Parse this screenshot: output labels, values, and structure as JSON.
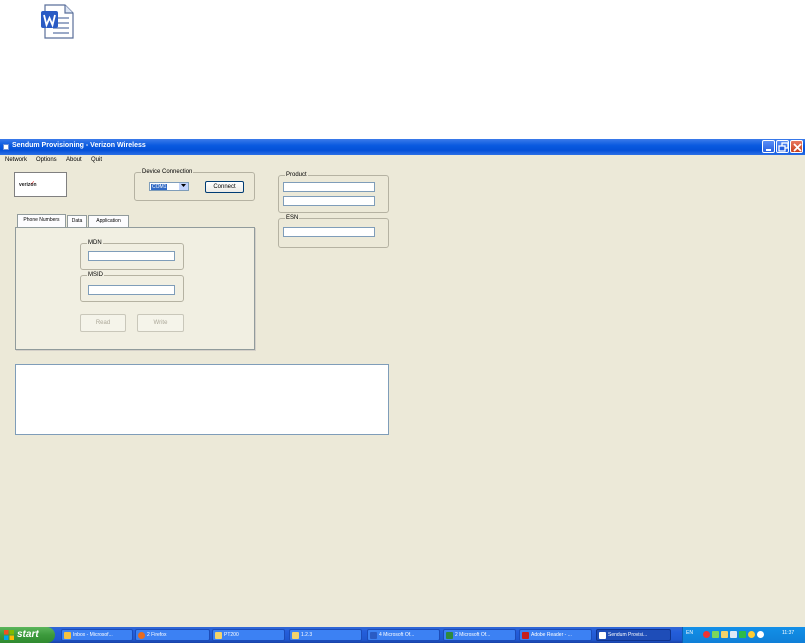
{
  "window": {
    "title": "Sendum Provisioning - Verizon Wireless"
  },
  "menu": [
    "Network",
    "Options",
    "About",
    "Quit"
  ],
  "logo": {
    "text": "verizon"
  },
  "device_connection": {
    "label": "Device Connection",
    "port_value": "COM1",
    "connect_label": "Connect"
  },
  "product": {
    "label": "Product"
  },
  "esn": {
    "label": "ESN"
  },
  "tabs": [
    "Phone Numbers",
    "Data",
    "Application"
  ],
  "phone_numbers": {
    "mdn_label": "MDN",
    "msid_label": "MSID",
    "read_label": "Read",
    "write_label": "Write"
  },
  "taskbar": {
    "start_label": "start",
    "tasks": [
      "Inbox - Microsof...",
      "2 Firefox",
      "PT200",
      "1.2.3",
      "4 Microsoft Of...",
      "2 Microsoft Of...",
      "Adobe Reader - ...",
      "Sendum Provisi..."
    ],
    "language": "EN",
    "clock": "11:37"
  },
  "colors": {
    "titlebar": "#0450d8",
    "window_bg": "#ece9d8",
    "taskbar": "#245edb",
    "start": "#3c9a3c",
    "selection": "#316ac5"
  }
}
